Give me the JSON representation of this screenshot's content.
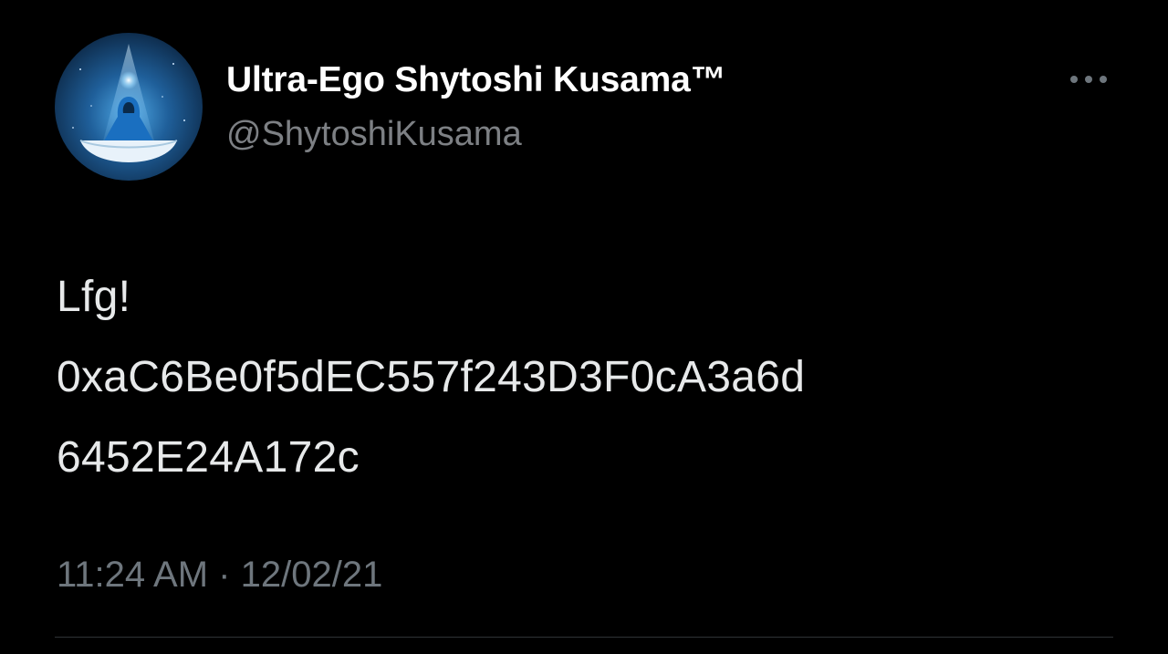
{
  "user": {
    "display_name": "Ultra-Ego Shytoshi Kusama™",
    "handle": "@ShytoshiKusama",
    "avatar_icon": "meditating-figure-avatar"
  },
  "menu": {
    "icon": "more-horizontal-icon"
  },
  "tweet": {
    "lines": [
      "Lfg!",
      "0xaC6Be0f5dEC557f243D3F0cA3a6d",
      "6452E24A172c"
    ],
    "time": "11:24 AM",
    "separator": "·",
    "date": "12/02/21"
  },
  "colors": {
    "background": "#000000",
    "text": "#e7e9ea",
    "secondary": "#7d8084",
    "divider": "#2f3336"
  }
}
